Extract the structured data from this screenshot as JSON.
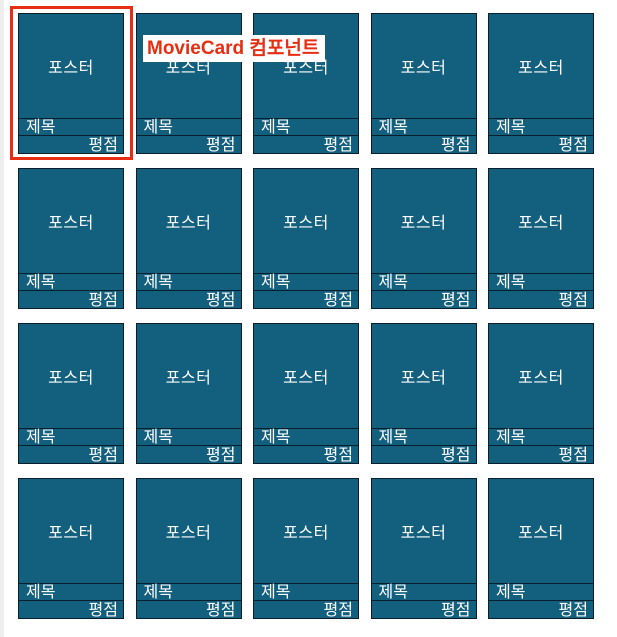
{
  "annotation": {
    "label": "MovieCard 컴포넌트",
    "color": "#e62e12"
  },
  "card_style": {
    "background": "#135f7e",
    "border": "#0a1e2c",
    "text": "#ffffff"
  },
  "cards": [
    {
      "poster": "포스터",
      "title": "제목",
      "rating": "평점"
    },
    {
      "poster": "포스터",
      "title": "제목",
      "rating": "평점"
    },
    {
      "poster": "포스터",
      "title": "제목",
      "rating": "평점"
    },
    {
      "poster": "포스터",
      "title": "제목",
      "rating": "평점"
    },
    {
      "poster": "포스터",
      "title": "제목",
      "rating": "평점"
    },
    {
      "poster": "포스터",
      "title": "제목",
      "rating": "평점"
    },
    {
      "poster": "포스터",
      "title": "제목",
      "rating": "평점"
    },
    {
      "poster": "포스터",
      "title": "제목",
      "rating": "평점"
    },
    {
      "poster": "포스터",
      "title": "제목",
      "rating": "평점"
    },
    {
      "poster": "포스터",
      "title": "제목",
      "rating": "평점"
    },
    {
      "poster": "포스터",
      "title": "제목",
      "rating": "평점"
    },
    {
      "poster": "포스터",
      "title": "제목",
      "rating": "평점"
    },
    {
      "poster": "포스터",
      "title": "제목",
      "rating": "평점"
    },
    {
      "poster": "포스터",
      "title": "제목",
      "rating": "평점"
    },
    {
      "poster": "포스터",
      "title": "제목",
      "rating": "평점"
    },
    {
      "poster": "포스터",
      "title": "제목",
      "rating": "평점"
    },
    {
      "poster": "포스터",
      "title": "제목",
      "rating": "평점"
    },
    {
      "poster": "포스터",
      "title": "제목",
      "rating": "평점"
    },
    {
      "poster": "포스터",
      "title": "제목",
      "rating": "평점"
    },
    {
      "poster": "포스터",
      "title": "제목",
      "rating": "평점"
    }
  ]
}
